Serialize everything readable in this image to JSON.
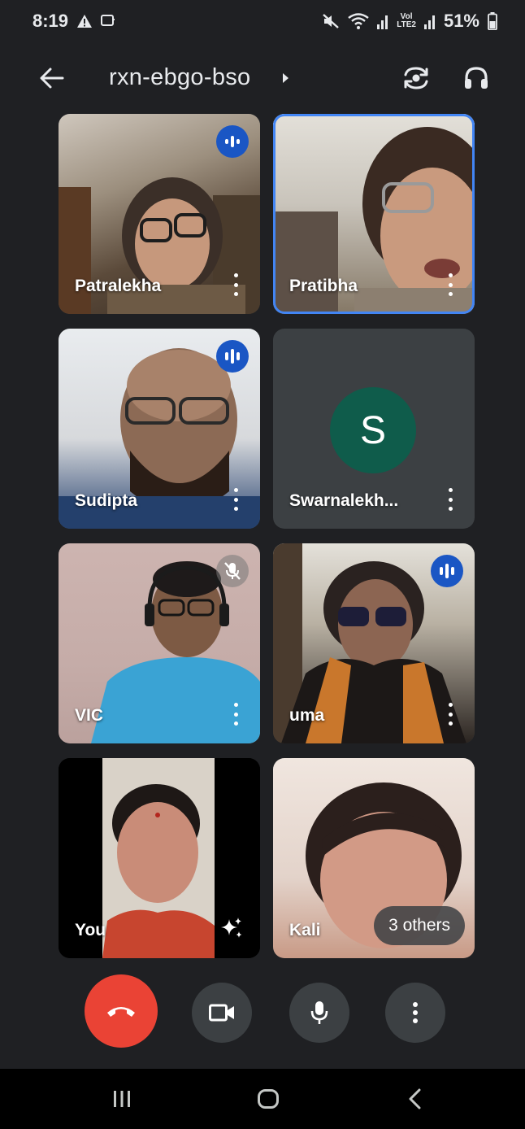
{
  "status_bar": {
    "time": "8:19",
    "network_top": "Vol",
    "network_bottom": "LTE2",
    "battery": "51%",
    "icons": [
      "alert-icon",
      "cast-icon",
      "mute-icon",
      "wifi-icon",
      "signal-icon",
      "battery-icon"
    ]
  },
  "header": {
    "meeting_code": "rxn-ebgo-bso",
    "icons": [
      "back-arrow-icon",
      "caret-right-icon",
      "switch-camera-icon",
      "headphones-icon"
    ]
  },
  "tiles": [
    {
      "name": "Patralekha",
      "status": "speaking",
      "active": false
    },
    {
      "name": "Pratibha",
      "status": "none",
      "active": true
    },
    {
      "name": "Sudipta",
      "status": "speaking",
      "active": false
    },
    {
      "name": "Swarnalekh...",
      "status": "none",
      "avatar_letter": "S",
      "active": false
    },
    {
      "name": "VIC",
      "status": "muted",
      "active": false
    },
    {
      "name": "uma",
      "status": "speaking",
      "active": false
    },
    {
      "name": "You",
      "status": "self",
      "active": false
    },
    {
      "name": "Kali",
      "status": "none",
      "active": false,
      "others_label": "3 others"
    }
  ],
  "controls": [
    "end-call-icon",
    "camera-icon",
    "microphone-icon",
    "more-vert-icon"
  ],
  "nav": [
    "recents-icon",
    "home-icon",
    "back-chevron-icon"
  ],
  "colors": {
    "background": "#1f2023",
    "end_call": "#ea4335",
    "control_bg": "#3c4043",
    "speaking_badge": "#1a56c4",
    "active_border": "#4285f4",
    "avatar_bg": "#0f5c4b"
  }
}
